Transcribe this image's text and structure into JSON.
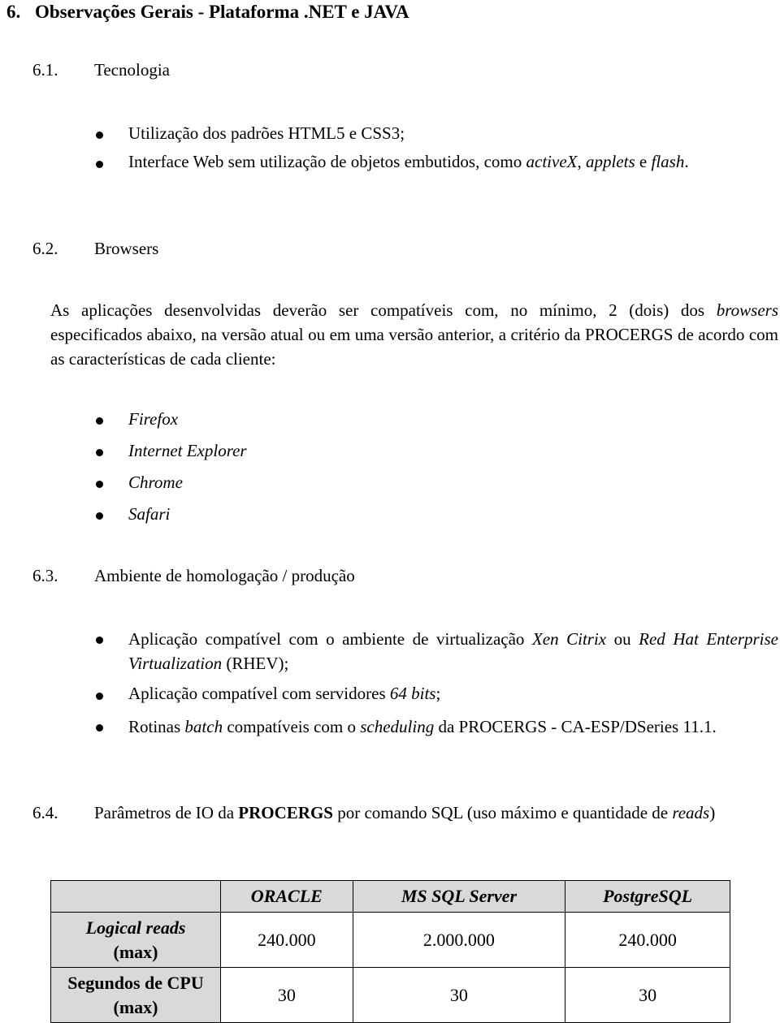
{
  "section": {
    "number": "6.",
    "title": "Observações Gerais - Plataforma .NET e JAVA"
  },
  "s61": {
    "number": "6.1.",
    "title": "Tecnologia",
    "items": [
      "Utilização dos padrões HTML5 e CSS3;",
      {
        "pre": "Interface Web sem utilização de objetos embutidos, como ",
        "i1": "activeX",
        "mid": ", ",
        "i2": "applets",
        "mid2": " e ",
        "i3": "flash",
        "post": "."
      }
    ]
  },
  "s62": {
    "number": "6.2.",
    "title": "Browsers",
    "para_pre": "As aplicações desenvolvidas deverão ser compatíveis com, no mínimo, 2 (dois) dos ",
    "para_italic": "browsers",
    "para_post": " especificados abaixo, na versão atual ou em uma versão anterior, a critério da PROCERGS de acordo com as características de cada cliente:",
    "browsers": [
      "Firefox",
      "Internet Explorer",
      "Chrome",
      "Safari"
    ]
  },
  "s63": {
    "number": "6.3.",
    "title": "Ambiente de homologação / produção",
    "item1": {
      "pre": "Aplicação compatível com o ambiente de virtualização ",
      "i1": "Xen Citrix",
      "mid": " ou ",
      "i2": "Red Hat Enterprise Virtualization",
      "post": " (RHEV);"
    },
    "item2": {
      "pre": "Aplicação compatível com servidores ",
      "i1": "64 bits",
      "post": ";"
    },
    "item3": {
      "pre": "Rotinas ",
      "i1": "batch",
      "mid": " compatíveis com o ",
      "i2": "scheduling",
      "post": " da PROCERGS - CA-ESP/DSeries 11.1."
    }
  },
  "s64": {
    "number": "6.4.",
    "title_pre": "Parâmetros de IO da ",
    "title_bold": "PROCERGS",
    "title_mid": " por comando SQL (uso máximo e quantidade de ",
    "title_italic": "reads",
    "title_post": ")"
  },
  "table": {
    "columns": [
      "",
      "ORACLE",
      "MS SQL Server",
      "PostgreSQL"
    ],
    "rows": [
      {
        "label_italic": "Logical reads",
        "label_sub": "(max)",
        "values": [
          "240.000",
          "2.000.000",
          "240.000"
        ]
      },
      {
        "label": "Segundos de CPU",
        "label_sub": "(max)",
        "values": [
          "30",
          "30",
          "30"
        ]
      }
    ],
    "shade_color": "#d9d9d9"
  }
}
